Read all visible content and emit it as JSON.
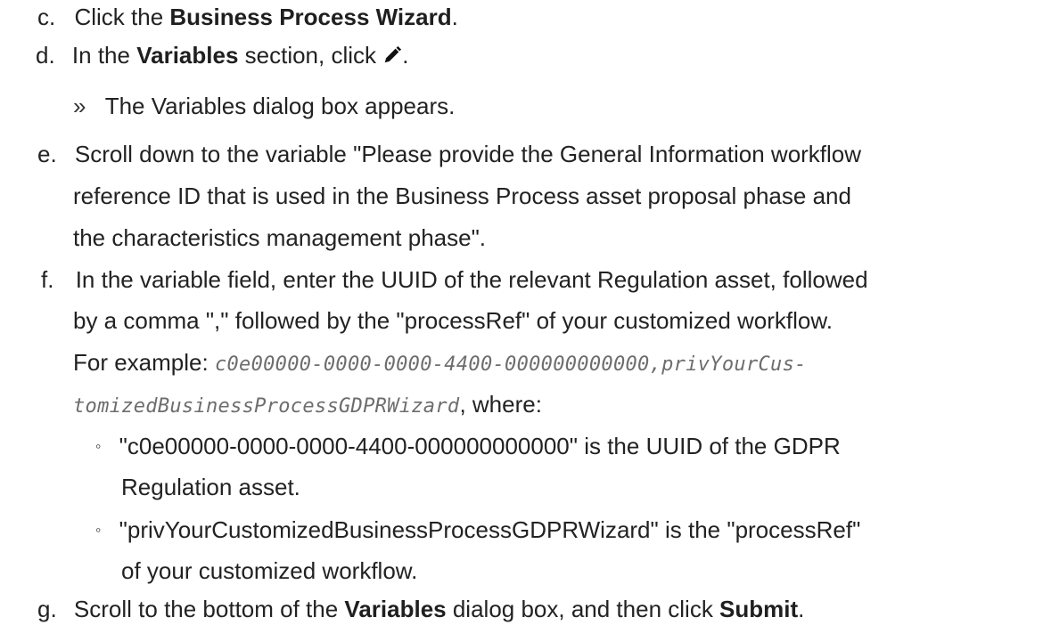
{
  "steps": {
    "c": {
      "label": "c.",
      "text_before": "Click the ",
      "bold": "Business Process Wizard",
      "text_after": "."
    },
    "d": {
      "label": "d.",
      "text_before": "In the ",
      "bold": "Variables",
      "text_after": " section, click ",
      "icon": "pencil-icon",
      "text_end": ".",
      "result": {
        "marker": "»",
        "text": "The Variables dialog box appears."
      }
    },
    "e": {
      "label": "e.",
      "lines": [
        "Scroll down to the variable \"Please provide the General Information workflow",
        "reference ID that is used in the Business Process asset proposal phase and",
        "the characteristics management phase\"."
      ]
    },
    "f": {
      "label": "f.",
      "lines": [
        "In the variable field, enter the UUID of the relevant Regulation asset, followed",
        "by a comma \",\" followed by the \"processRef\" of your customized workflow."
      ],
      "example_prefix": "For example: ",
      "example_code_1": "c0e00000-0000-0000-4400-000000000000,privYourCus-",
      "example_code_2": "tomizedBusinessProcessGDPRWizard",
      "example_suffix": ", where:",
      "bullets": [
        {
          "marker": "◦",
          "lines": [
            "\"c0e00000-0000-0000-4400-000000000000\" is the UUID of the GDPR",
            "Regulation asset."
          ]
        },
        {
          "marker": "◦",
          "lines": [
            "\"privYourCustomizedBusinessProcessGDPRWizard\" is the \"processRef\"",
            "of your customized workflow."
          ]
        }
      ]
    },
    "g": {
      "label": "g.",
      "text_before": "Scroll to the bottom of the ",
      "bold1": "Variables",
      "text_mid": " dialog box, and then click ",
      "bold2": "Submit",
      "text_after": "."
    }
  }
}
